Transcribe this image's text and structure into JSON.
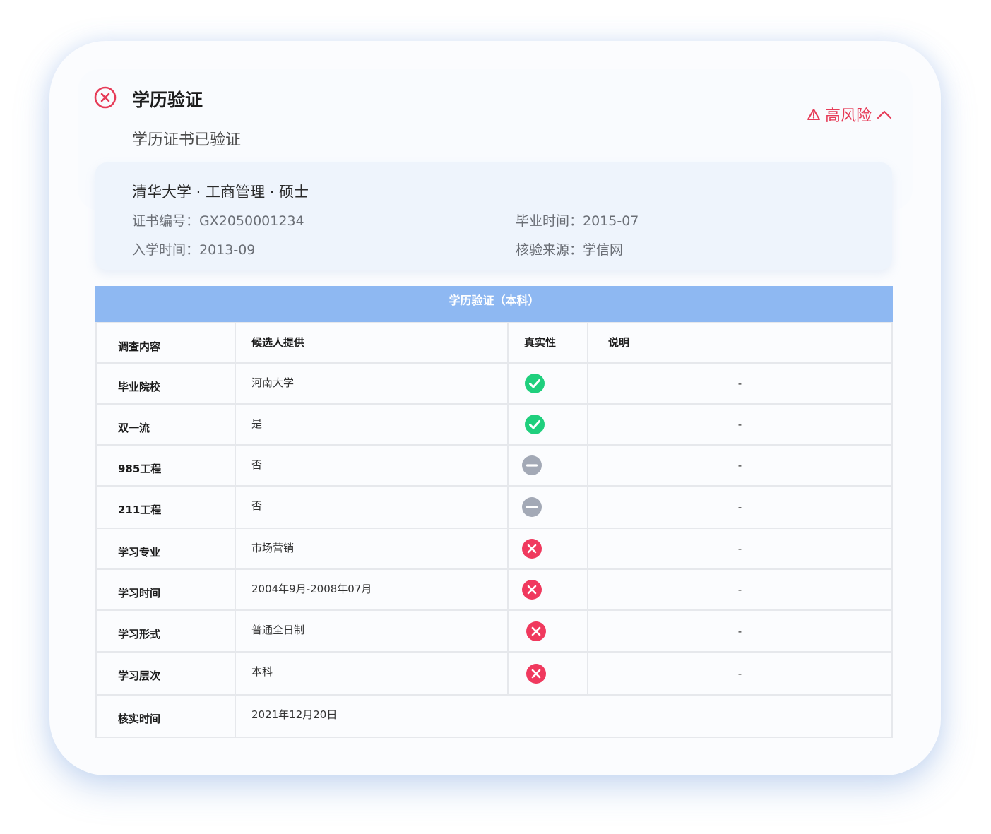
{
  "header": {
    "title": "学历验证",
    "subtitle": "学历证书已验证",
    "status_icon": "x-circle-icon",
    "risk_label": "高风险",
    "risk_icon": "warning-icon",
    "collapse_icon": "chevron-up-icon",
    "risk_color": "#e63b57"
  },
  "info": {
    "headline": "清华大学 · 工商管理 · 硕士",
    "cert_no": "证书编号：GX2050001234",
    "grad_time": "毕业时间：2015-07",
    "enroll_time": "入学时间：2013-09",
    "source": "核验来源：学信网"
  },
  "table": {
    "caption": "学历验证（本科）",
    "caption_color": "#8eb8f2",
    "headers": [
      "调查内容",
      "候选人提供",
      "真实性",
      "说明"
    ],
    "rows": [
      {
        "item": "毕业院校",
        "value": "河南大学",
        "status": "verified",
        "note": "-"
      },
      {
        "item": "双一流",
        "value": "是",
        "status": "verified",
        "note": "-"
      },
      {
        "item": "985工程",
        "value": "否",
        "status": "neutral",
        "note": "-"
      },
      {
        "item": "211工程",
        "value": "否",
        "status": "neutral",
        "note": "-"
      },
      {
        "item": "学习专业",
        "value": "市场营销",
        "status": "failed",
        "note": "-"
      },
      {
        "item": "学习时间",
        "value": "2004年9月-2008年07月",
        "status": "failed",
        "note": "-"
      },
      {
        "item": "学习形式",
        "value": "普通全日制",
        "status": "failed",
        "note": "-"
      },
      {
        "item": "学习层次",
        "value": "本科",
        "status": "failed",
        "note": "-"
      }
    ],
    "footer": {
      "item": "核实时间",
      "value": "2021年12月20日"
    },
    "status_colors": {
      "verified": "#1fcf7d",
      "neutral": "#a3a9b6",
      "failed": "#f0395e"
    }
  }
}
